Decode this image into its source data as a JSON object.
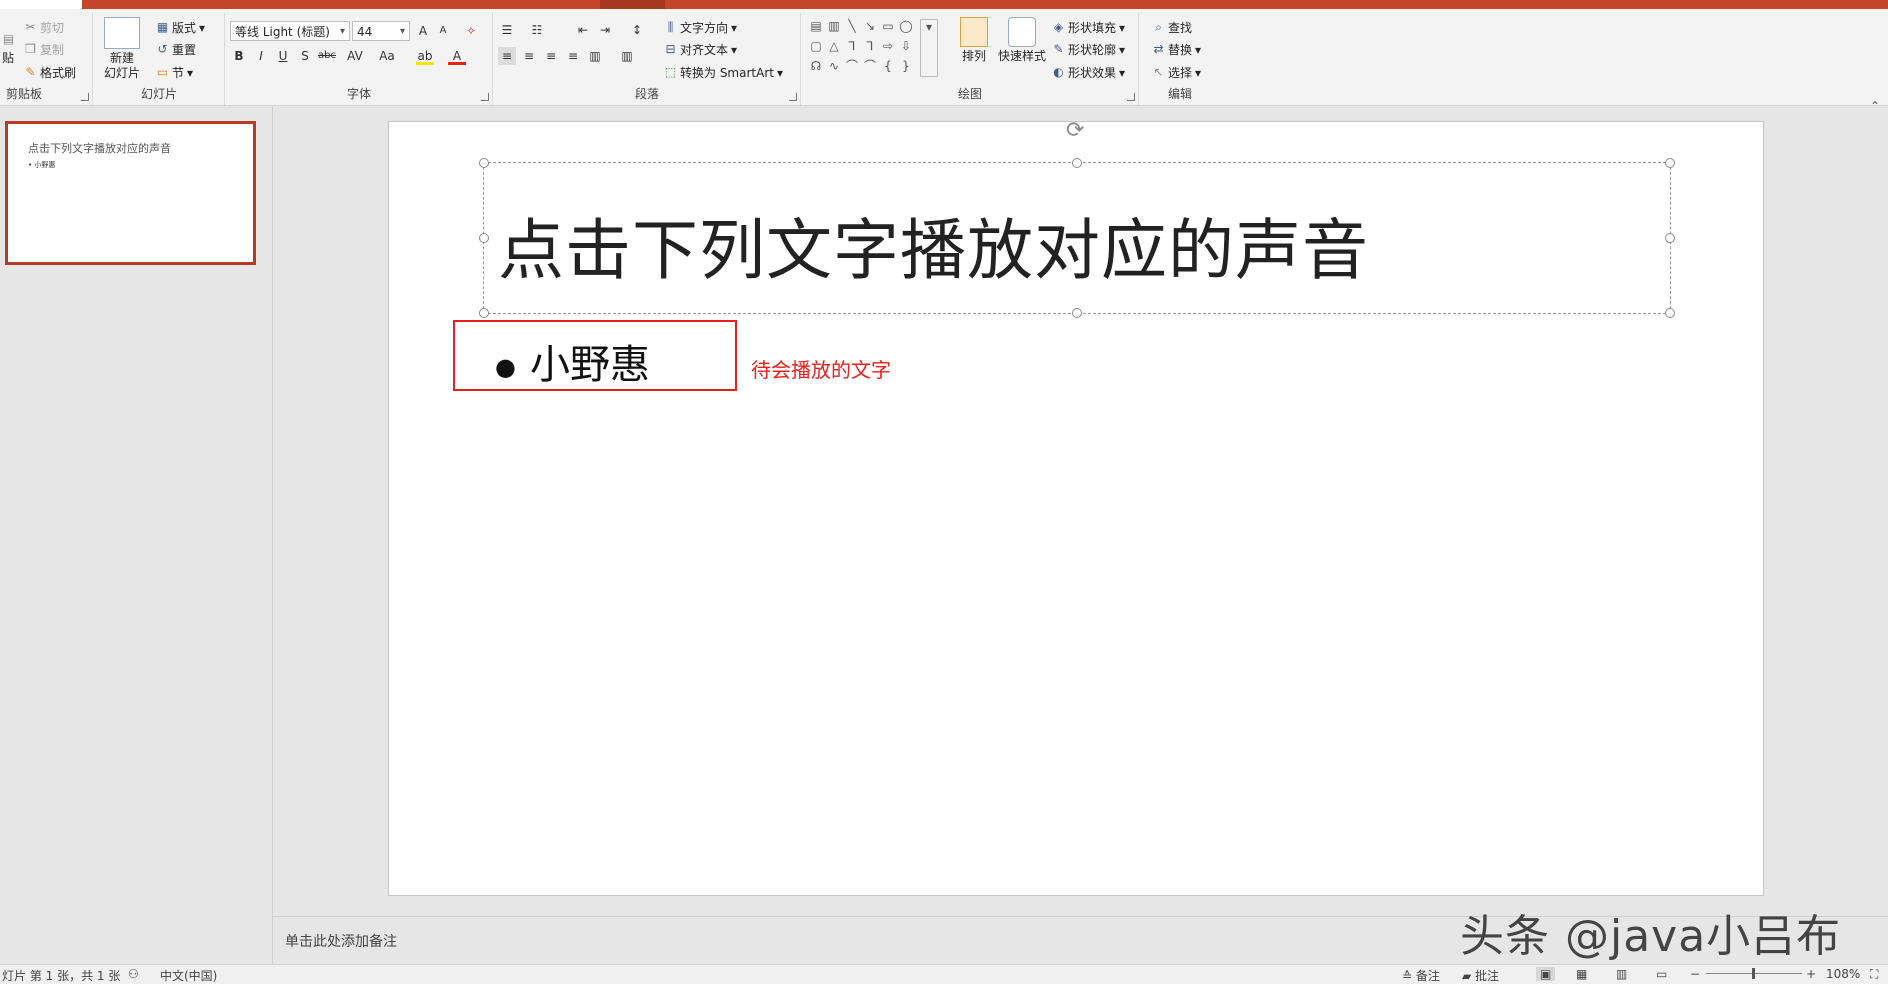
{
  "ribbon": {
    "clipboard": {
      "paste": "贴",
      "cut": "剪切",
      "copy": "复制",
      "painter": "格式刷",
      "label": "剪贴板"
    },
    "slides": {
      "new_slide_l1": "新建",
      "new_slide_l2": "幻灯片",
      "layout": "版式",
      "reset": "重置",
      "section": "节",
      "label": "幻灯片"
    },
    "font": {
      "name": "等线 Light (标题)",
      "size": "44",
      "bold": "B",
      "italic": "I",
      "underline": "U",
      "shadow": "S",
      "strike": "abc",
      "spacing": "AV",
      "case": "Aa",
      "grow": "A",
      "shrink": "A",
      "highlight": "ab",
      "color": "A",
      "label": "字体"
    },
    "paragraph": {
      "text_direction": "文字方向",
      "align_text": "对齐文本",
      "smartart": "转换为 SmartArt",
      "label": "段落"
    },
    "drawing": {
      "arrange": "排列",
      "quick_styles": "快速样式",
      "fill": "形状填充",
      "outline": "形状轮廓",
      "effects": "形状效果",
      "label": "绘图"
    },
    "editing": {
      "find": "查找",
      "replace": "替换",
      "select": "选择",
      "label": "编辑"
    }
  },
  "thumbnail": {
    "title": "点击下列文字播放对应的声音",
    "bullet": "• 小野惠"
  },
  "slide": {
    "title": "点击下列文字播放对应的声音",
    "bullet": "小野惠",
    "annotation": "待会播放的文字"
  },
  "notes_placeholder": "单击此处添加备注",
  "watermark": "头条 @java小吕布",
  "status": {
    "slide_info": "灯片 第 1 张，共 1 张",
    "language": "中文(中国)",
    "notes": "备注",
    "comments": "批注",
    "zoom": "108%"
  },
  "colors": {
    "accent": "#c4452a",
    "highlight_box": "#e5211d"
  }
}
